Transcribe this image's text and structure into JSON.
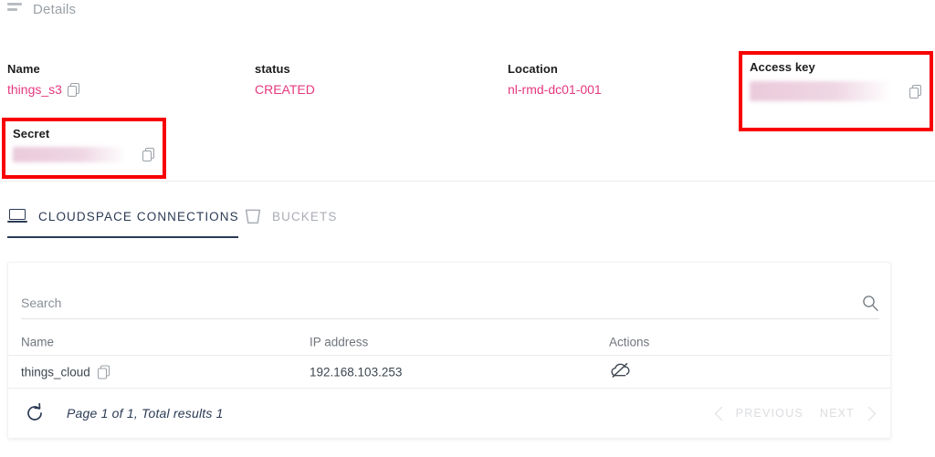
{
  "topbar": {
    "menu_icon": "menu-icon",
    "title": "Details"
  },
  "details": {
    "fields": [
      {
        "label": "Name",
        "value": "things_s3",
        "masked": false,
        "copyable": true
      },
      {
        "label": "status",
        "value": "CREATED",
        "masked": false,
        "copyable": false
      },
      {
        "label": "Location",
        "value": "nl-rmd-dc01-001",
        "masked": false,
        "copyable": false
      }
    ],
    "secret": {
      "label": "Secret",
      "value": "",
      "masked": true,
      "copyable": true,
      "annotation_color": "#f90000"
    },
    "access_key": {
      "label": "Access key",
      "value": "",
      "masked": true,
      "copyable": true,
      "annotation_color": "#f90000"
    },
    "accent_color": "#e5387f",
    "copy_icon": "copy-icon"
  },
  "tabs": [
    {
      "label": "CLOUDSPACE CONNECTIONS",
      "icon": "laptop-icon",
      "active": true
    },
    {
      "label": "BUCKETS",
      "icon": "bucket-icon",
      "active": false
    }
  ],
  "table": {
    "search": {
      "placeholder": "Search",
      "value": "",
      "icon": "search-icon"
    },
    "columns": [
      "Name",
      "IP address",
      "Actions"
    ],
    "rows": [
      {
        "name": "things_cloud",
        "ip": "192.168.103.253",
        "action_icon": "cloud-off-icon"
      }
    ],
    "footer": {
      "refresh_icon": "refresh-icon",
      "page_info": "Page 1 of 1, Total results 1",
      "previous_label": "PREVIOUS",
      "next_label": "NEXT",
      "previous_enabled": false,
      "next_enabled": false
    }
  },
  "theme": {
    "accent": "#e5387f",
    "tab_active": "#2b3a55",
    "tab_inactive": "#a9adb4",
    "annotation": "#f90000"
  }
}
